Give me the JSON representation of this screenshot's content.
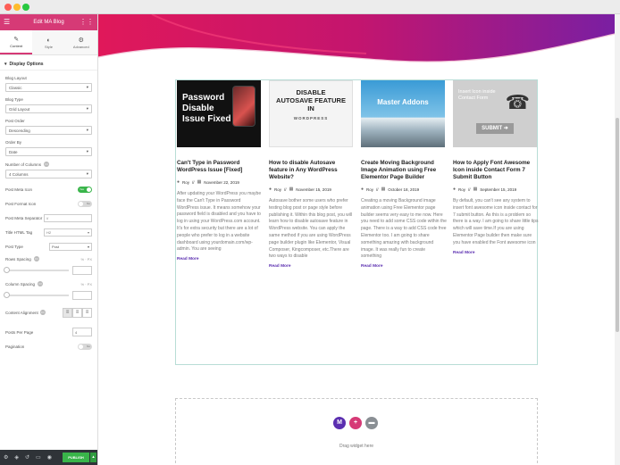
{
  "window": {
    "buttons": [
      "close",
      "minimize",
      "zoom"
    ]
  },
  "sidebar": {
    "title": "Edit MA Blog",
    "tabs": [
      {
        "label": "Content",
        "icon": "pencil-icon"
      },
      {
        "label": "Style",
        "icon": "circle-half-icon"
      },
      {
        "label": "Advanced",
        "icon": "gear-icon"
      }
    ],
    "section_title": "Display Options",
    "controls": {
      "blog_layout": {
        "label": "Blog Layout",
        "value": "Classic"
      },
      "blog_type": {
        "label": "Blog Type",
        "value": "Grid Layout"
      },
      "post_order": {
        "label": "Post Order",
        "value": "Descending"
      },
      "order_by": {
        "label": "Order By",
        "value": "Date"
      },
      "number_of_columns": {
        "label": "Number of Columns",
        "value": "4 Columns"
      },
      "post_meta_icon": {
        "label": "Post Meta Icon",
        "value": "Yes"
      },
      "post_format_icon": {
        "label": "Post Format Icon",
        "value": "No"
      },
      "post_meta_separator": {
        "label": "Post Meta Separator",
        "value": "//"
      },
      "title_html_tag": {
        "label": "Title HTML Tag",
        "value": "H2"
      },
      "post_type": {
        "label": "Post Type",
        "value": "Post"
      },
      "rows_spacing": {
        "label": "Rows Spacing",
        "unit": "% · PX"
      },
      "column_spacing": {
        "label": "Column Spacing",
        "unit": "% · PX"
      },
      "content_alignment": {
        "label": "Content Alignment"
      },
      "posts_per_page": {
        "label": "Posts Per Page",
        "value": "4"
      },
      "pagination": {
        "label": "Pagination",
        "value": "No"
      }
    },
    "footer": {
      "publish_label": "PUBLISH"
    }
  },
  "posts": [
    {
      "thumb_text": [
        "Password",
        "Disable",
        "Issue Fixed"
      ],
      "title": "Can't Type in Password WordPress Issue [Fixed]",
      "author": "Roy",
      "separator": "//",
      "date": "November 22, 2019",
      "excerpt": "After updating your WordPress you maybe face the Can't Type in Password WordPress issue. It means somehow your password field is disabled and you have to log in using your WordPress.com account. It's for extra security but there are a lot of people who prefer to log in a website dashboard using yourdomain.com/wp-admin. You are seeing",
      "read_more": "Read More"
    },
    {
      "thumb_text": [
        "DISABLE",
        "AUTOSAVE FEATURE",
        "IN",
        "WORDPRESS"
      ],
      "title": "How to disable Autosave feature in Any WordPress Website?",
      "author": "Roy",
      "separator": "//",
      "date": "November 15, 2019",
      "excerpt": "Autosave bother some users who prefer testing blog post or page style before publishing it. Within this blog post, you will learn how to disable autosave feature in WordPress website. You can apply the same method if you are using WordPress page builder plugin like Elementor, Visual Composer, Kingcomposer, etc.There are two ways to disable",
      "read_more": "Read More"
    },
    {
      "thumb_text": [
        "Master Addons"
      ],
      "title": "Create Moving Background Image Animation using Free Elementor Page Builder",
      "author": "Roy",
      "separator": "//",
      "date": "October 18, 2019",
      "excerpt": "Creating a moving Background image animation using Free Elementor page builder seems very easy to me now. Here you need to add some CSS code within the page. There is a way to add CSS code free Elementor too. I am going to share something amazing with background image. It was really fun to create something",
      "read_more": "Read More"
    },
    {
      "thumb_text": [
        "Insert Icon inside",
        "Contact Form",
        "SUBMIT"
      ],
      "title": "How to Apply Font Awesome Icon inside Contact Form 7 Submit Button",
      "author": "Roy",
      "separator": "//",
      "date": "September 15, 2019",
      "excerpt": "By default, you can't see any system to insert font awesome icon inside contact for 7 submit button. As this is a problem so there is a way. I am going to share little tips which will save time.If you are using Elementor Page builder then make sure you have enabled the Font awesome icon",
      "read_more": "Read More"
    }
  ],
  "drop_zone": {
    "text": "Drag widget here"
  },
  "colors": {
    "accent": "#d63a76",
    "publish": "#39b54a",
    "read_more": "#5b2fb0",
    "hero_magenta": "#d8175c",
    "hero_purple": "#7a1fa2"
  }
}
